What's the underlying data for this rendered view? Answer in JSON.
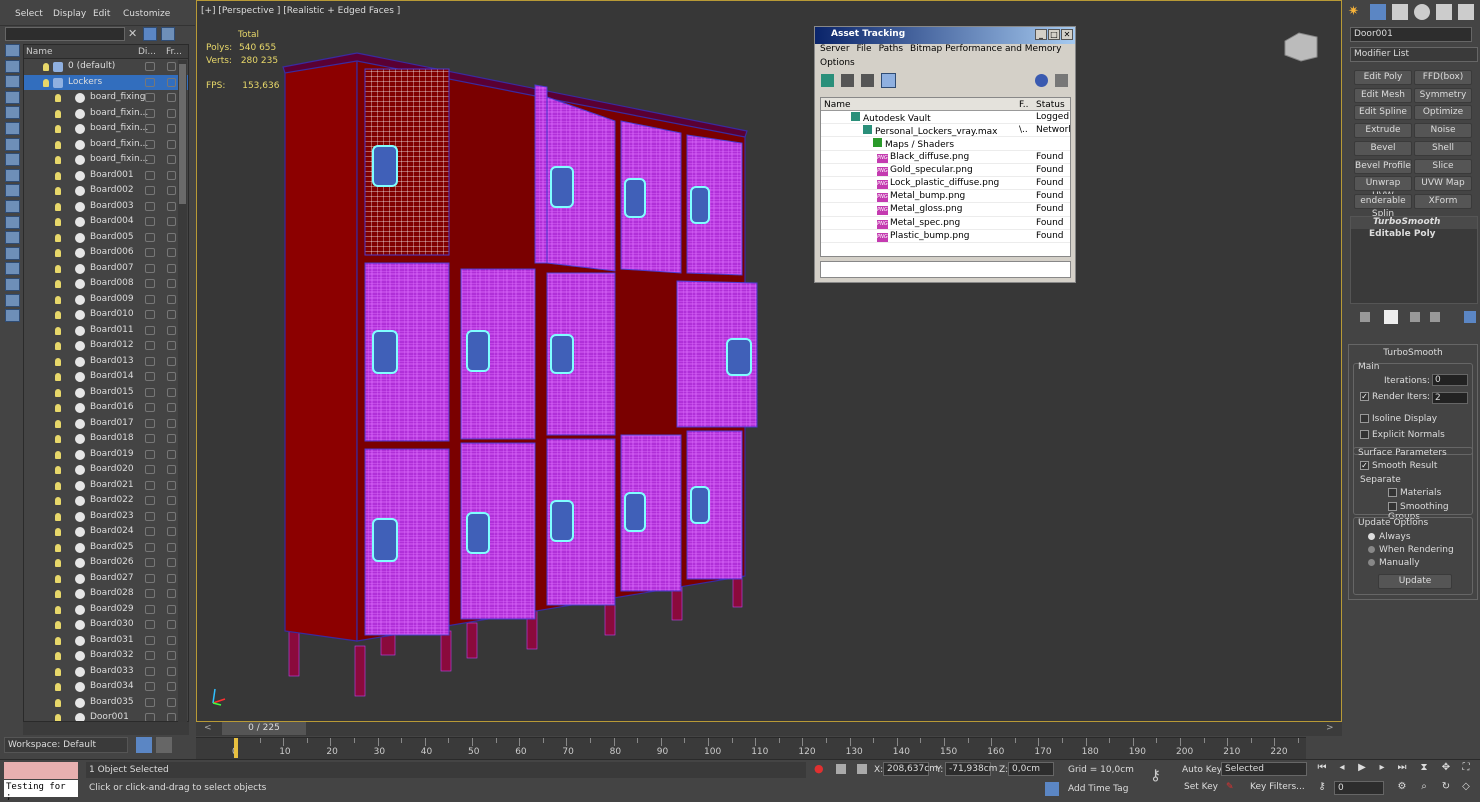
{
  "menu": {
    "items": [
      "Select",
      "Display",
      "Edit",
      "Customize"
    ]
  },
  "explorer": {
    "headers": {
      "name": "Name",
      "display": "Di...",
      "freeze": "Fr..."
    },
    "items": [
      "0 (default)",
      "Lockers",
      "board_fixing",
      "board_fixin...",
      "board_fixin...",
      "board_fixin...",
      "board_fixin...",
      "Board001",
      "Board002",
      "Board003",
      "Board004",
      "Board005",
      "Board006",
      "Board007",
      "Board008",
      "Board009",
      "Board010",
      "Board011",
      "Board012",
      "Board013",
      "Board014",
      "Board015",
      "Board016",
      "Board017",
      "Board018",
      "Board019",
      "Board020",
      "Board021",
      "Board022",
      "Board023",
      "Board024",
      "Board025",
      "Board026",
      "Board027",
      "Board028",
      "Board029",
      "Board030",
      "Board031",
      "Board032",
      "Board033",
      "Board034",
      "Board035",
      "Door001"
    ],
    "selected": "Lockers"
  },
  "workspace": "Workspace: Default",
  "viewport": {
    "label": "[+] [Perspective ] [Realistic + Edged Faces ]",
    "stats": {
      "total": "Total",
      "polys_label": "Polys:",
      "polys": "540 655",
      "verts_label": "Verts:",
      "verts": "280 235",
      "fps_label": "FPS:",
      "fps": "153,636"
    }
  },
  "asset": {
    "title": "Asset Tracking",
    "menu1": [
      "Server",
      "File",
      "Paths",
      "Bitmap Performance and Memory"
    ],
    "menu2": [
      "Options"
    ],
    "cols": {
      "name": "Name",
      "f": "F..",
      "status": "Status"
    },
    "rows": [
      {
        "name": "Autodesk Vault",
        "f": "",
        "status": "Logged O"
      },
      {
        "name": "Personal_Lockers_vray.max",
        "f": "\\..",
        "status": "Network I"
      },
      {
        "name": "Maps / Shaders",
        "f": "",
        "status": ""
      },
      {
        "name": "Black_diffuse.png",
        "f": "",
        "status": "Found"
      },
      {
        "name": "Gold_specular.png",
        "f": "",
        "status": "Found"
      },
      {
        "name": "Lock_plastic_diffuse.png",
        "f": "",
        "status": "Found"
      },
      {
        "name": "Metal_bump.png",
        "f": "",
        "status": "Found"
      },
      {
        "name": "Metal_gloss.png",
        "f": "",
        "status": "Found"
      },
      {
        "name": "Metal_spec.png",
        "f": "",
        "status": "Found"
      },
      {
        "name": "Plastic_bump.png",
        "f": "",
        "status": "Found"
      }
    ],
    "png_tag": "PNG"
  },
  "cmd": {
    "object_name": "Door001",
    "modifier_list": "Modifier List",
    "buttons": [
      "Edit Poly",
      "FFD(box)",
      "Edit Mesh",
      "Symmetry",
      "Edit Spline",
      "Optimize",
      "Extrude",
      "Noise",
      "Bevel",
      "Shell",
      "Bevel Profile",
      "Slice",
      "Unwrap UVW",
      "UVW Map",
      "enderable Splin",
      "XForm"
    ],
    "stack": [
      "TurboSmooth",
      "Editable Poly"
    ],
    "rollout_title": "TurboSmooth",
    "main": "Main",
    "iterations_label": "Iterations:",
    "iterations": "0",
    "render_iters_label": "Render Iters:",
    "render_iters": "2",
    "isoline": "Isoline Display",
    "explicit": "Explicit Normals",
    "surface": "Surface Parameters",
    "smooth_result": "Smooth Result",
    "separate": "Separate",
    "materials": "Materials",
    "smoothing_groups": "Smoothing Groups",
    "update_options": "Update Options",
    "always": "Always",
    "when_rendering": "When Rendering",
    "manually": "Manually",
    "update": "Update"
  },
  "timeline": {
    "frame": "0 / 225",
    "ticks": [
      "0",
      "10",
      "20",
      "30",
      "40",
      "50",
      "60",
      "70",
      "80",
      "90",
      "100",
      "110",
      "120",
      "130",
      "140",
      "150",
      "160",
      "170",
      "180",
      "190",
      "200",
      "210",
      "220"
    ]
  },
  "status": {
    "script": "Testing for ;",
    "selected": "1 Object Selected",
    "prompt": "Click or click-and-drag to select objects",
    "x_label": "X:",
    "x": "208,637cm",
    "y_label": "Y:",
    "y": "-71,938cm",
    "z_label": "Z:",
    "z": "0,0cm",
    "grid": "Grid = 10,0cm",
    "auto_key": "Auto Key",
    "set_key": "Set Key",
    "key_mode": "Selected",
    "key_filters": "Key Filters...",
    "add_time_tag": "Add Time Tag",
    "frame_field": "0"
  },
  "colors": {
    "cabinet": "#7a0000",
    "wire": "#c040f0",
    "selected_row": "#326ebe",
    "viewport_border": "#b89a36"
  }
}
